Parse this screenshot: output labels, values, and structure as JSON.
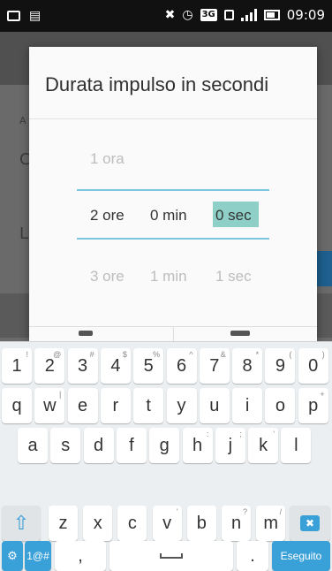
{
  "status_bar": {
    "time": "09:09",
    "badge": "3G",
    "icons": [
      "image-icon",
      "notification-icon",
      "mute-icon",
      "alarm-icon",
      "sim-icon",
      "signal-icon",
      "battery-icon"
    ]
  },
  "dialog": {
    "title": "Durata impulso in secondi",
    "picker": {
      "above": {
        "hours": "1 ora",
        "minutes": "",
        "seconds": ""
      },
      "selected": {
        "hours": "2 ore",
        "minutes": "0 min",
        "seconds": "0 sec"
      },
      "below": {
        "hours": "3 ore",
        "minutes": "1 min",
        "seconds": "1 sec"
      }
    },
    "accent_color": "#7cc7dd",
    "highlight_color": "#8ed0c7"
  },
  "keyboard": {
    "row_numbers": [
      {
        "label": "1",
        "hint": "!"
      },
      {
        "label": "2",
        "hint": "@"
      },
      {
        "label": "3",
        "hint": "#"
      },
      {
        "label": "4",
        "hint": "$"
      },
      {
        "label": "5",
        "hint": "%"
      },
      {
        "label": "6",
        "hint": "^"
      },
      {
        "label": "7",
        "hint": "&"
      },
      {
        "label": "8",
        "hint": "*"
      },
      {
        "label": "9",
        "hint": "("
      },
      {
        "label": "0",
        "hint": ")"
      }
    ],
    "row_q": [
      {
        "label": "q",
        "hint": ""
      },
      {
        "label": "w",
        "hint": "|"
      },
      {
        "label": "e",
        "hint": ""
      },
      {
        "label": "r",
        "hint": ""
      },
      {
        "label": "t",
        "hint": ""
      },
      {
        "label": "y",
        "hint": ""
      },
      {
        "label": "u",
        "hint": ""
      },
      {
        "label": "i",
        "hint": ""
      },
      {
        "label": "o",
        "hint": ""
      },
      {
        "label": "p",
        "hint": "+"
      }
    ],
    "row_a": [
      {
        "label": "a",
        "hint": ""
      },
      {
        "label": "s",
        "hint": ""
      },
      {
        "label": "d",
        "hint": ""
      },
      {
        "label": "f",
        "hint": ""
      },
      {
        "label": "g",
        "hint": ""
      },
      {
        "label": "h",
        "hint": ":"
      },
      {
        "label": "j",
        "hint": ";"
      },
      {
        "label": "k",
        "hint": "'"
      },
      {
        "label": "l",
        "hint": ""
      }
    ],
    "row_z": [
      {
        "label": "z",
        "hint": ""
      },
      {
        "label": "x",
        "hint": ""
      },
      {
        "label": "c",
        "hint": ""
      },
      {
        "label": "v",
        "hint": "'"
      },
      {
        "label": "b",
        "hint": ""
      },
      {
        "label": "n",
        "hint": "?"
      },
      {
        "label": "m",
        "hint": "/"
      }
    ],
    "symbols_label": "1@#",
    "comma_label": ",",
    "period_label": ".",
    "done_label": "Eseguito",
    "shift_icon": "shift-icon",
    "backspace_icon": "backspace-icon",
    "settings_icon": "gear-icon"
  }
}
